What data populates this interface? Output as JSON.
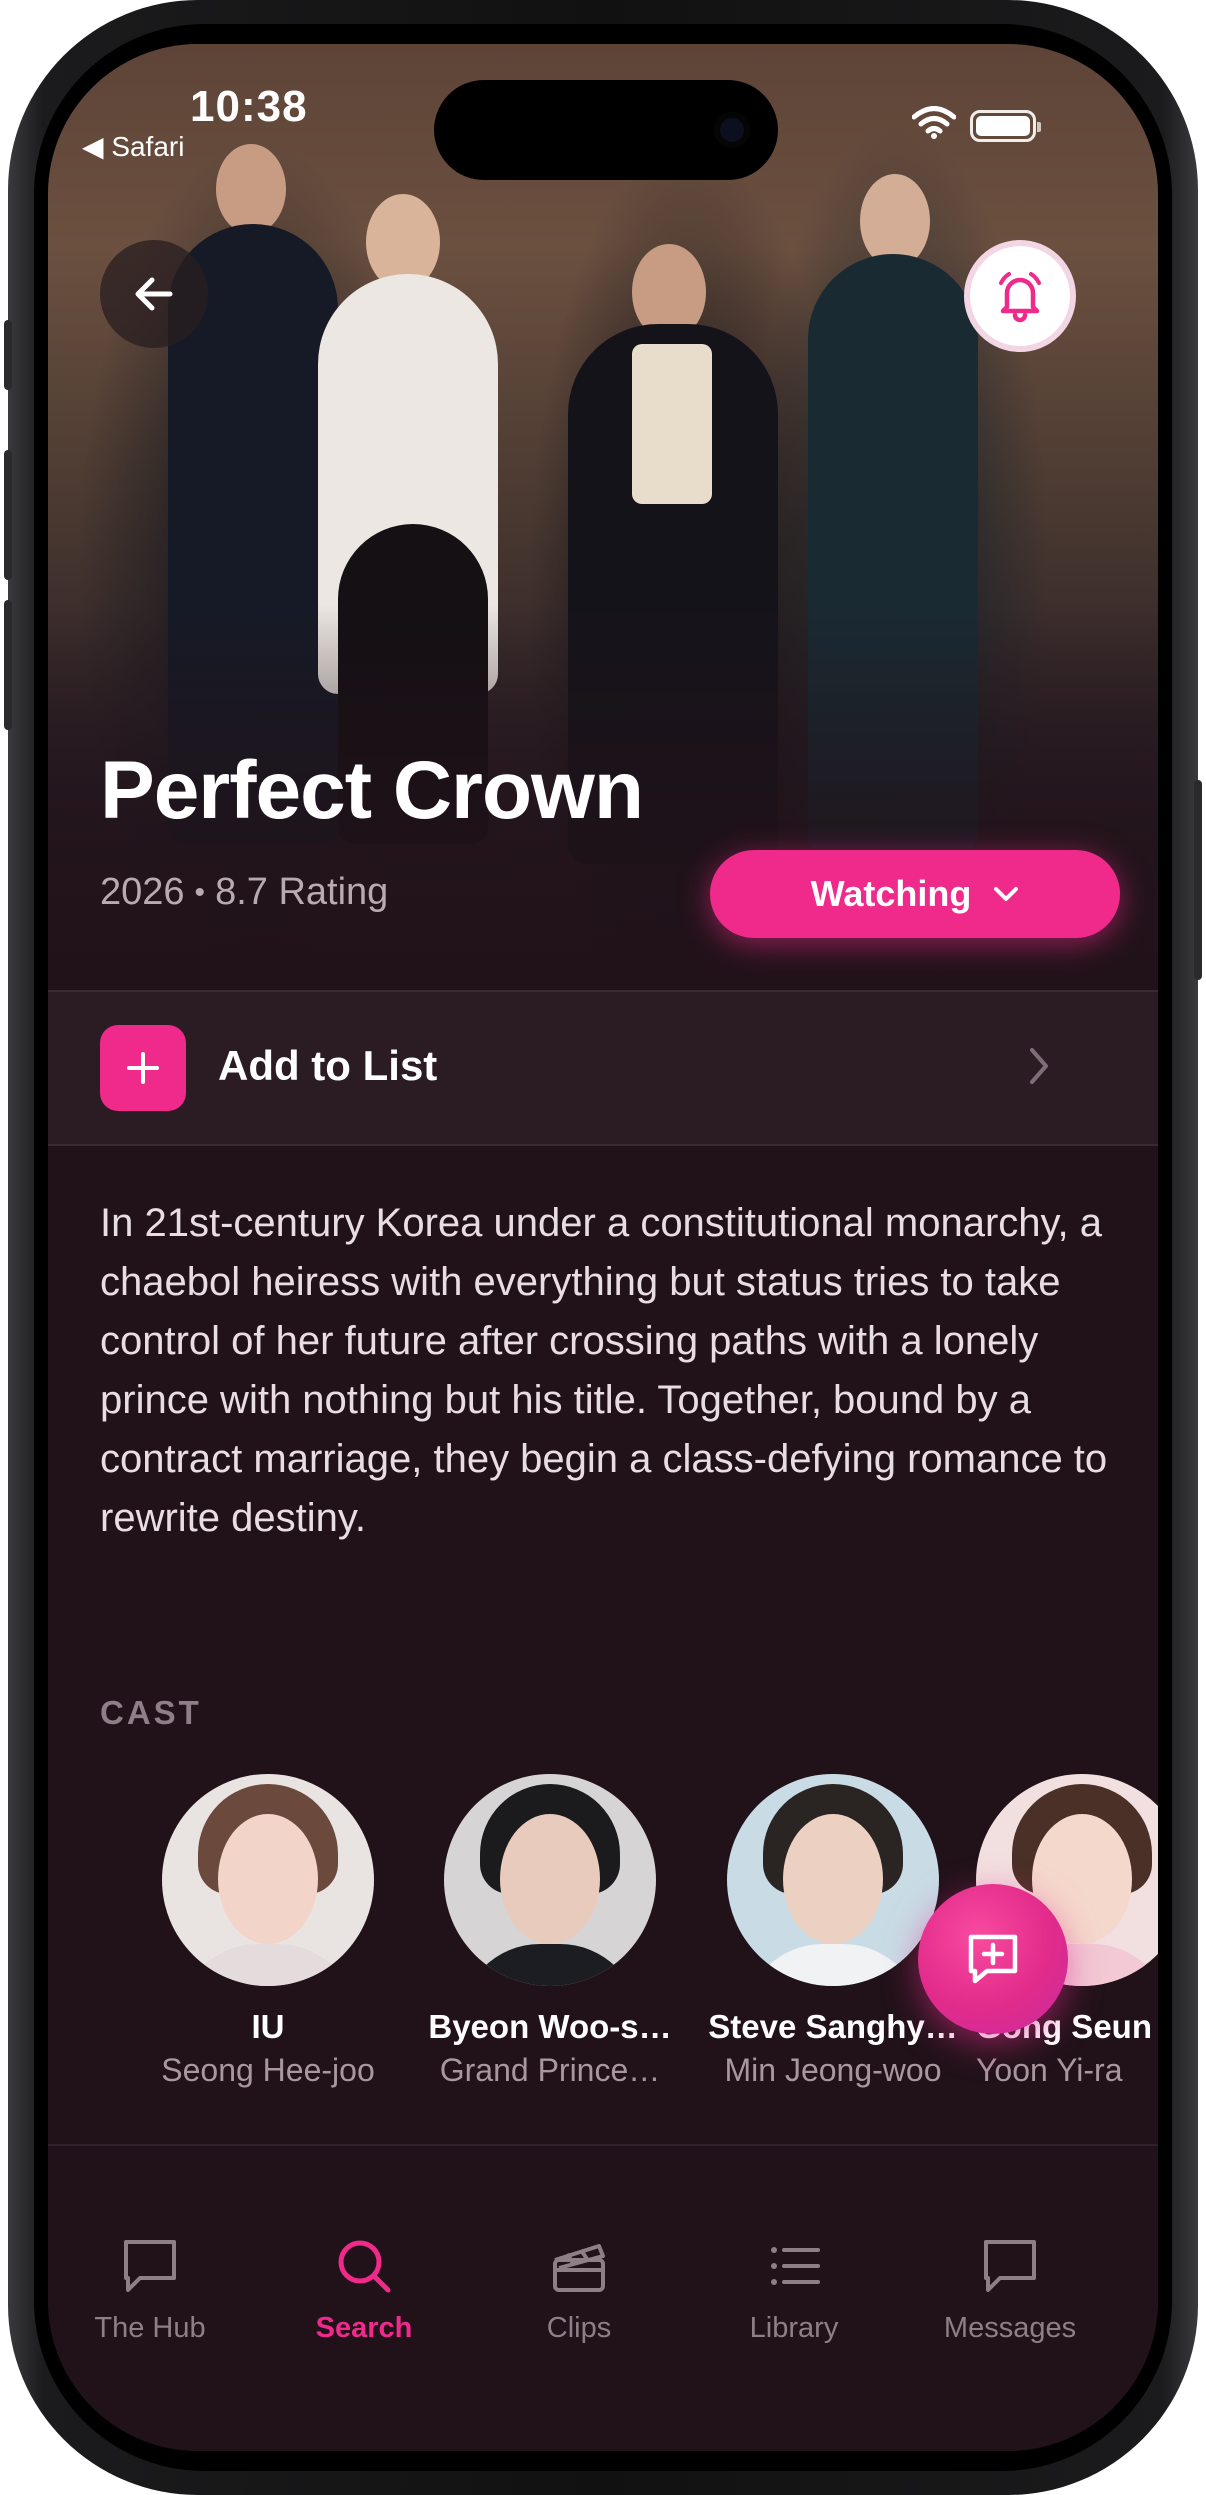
{
  "status_bar": {
    "time": "10:38",
    "back_app": "◀ Safari"
  },
  "show": {
    "title": "Perfect Crown",
    "year": "2026",
    "rating": "8.7 Rating",
    "status_button": "Watching",
    "add_to_list": "Add to List",
    "description": "In 21st-century Korea under a constitutional monarchy, a chaebol heiress with everything but status tries to take control of her future after crossing paths with a lonely prince with nothing but his title. Together, bound by a contract marriage, they begin a class-defying romance to rewrite destiny."
  },
  "cast": {
    "label": "CAST",
    "members": [
      {
        "name": "IU",
        "role": "Seong Hee-joo"
      },
      {
        "name": "Byeon Woo-s…",
        "role": "Grand Prince…"
      },
      {
        "name": "Steve Sanghy…",
        "role": "Min Jeong-woo"
      },
      {
        "name": "Gong Seun",
        "role": "Yoon Yi-ra"
      }
    ]
  },
  "tabs": [
    {
      "label": "The Hub",
      "icon": "chat-bubble-icon",
      "active": false
    },
    {
      "label": "Search",
      "icon": "search-icon",
      "active": true
    },
    {
      "label": "Clips",
      "icon": "clapperboard-icon",
      "active": false
    },
    {
      "label": "Library",
      "icon": "list-icon",
      "active": false
    },
    {
      "label": "Messages",
      "icon": "message-icon",
      "active": false
    }
  ],
  "colors": {
    "accent": "#ef2a8a",
    "background": "#211219",
    "row_background": "#2b1c24"
  }
}
